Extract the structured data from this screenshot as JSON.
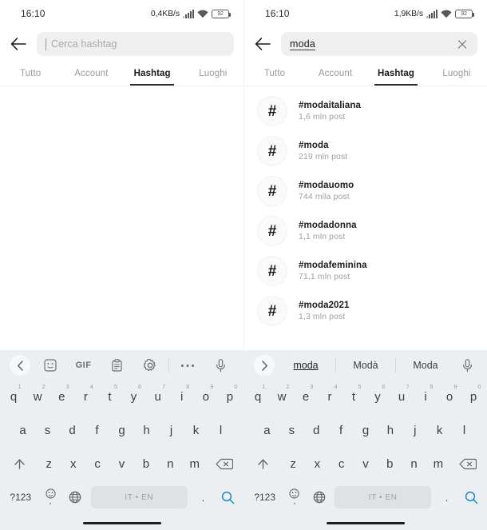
{
  "panels": [
    {
      "id": "left",
      "status": {
        "time": "16:10",
        "net_speed": "0,4KB/s",
        "battery": "92"
      },
      "search": {
        "placeholder": "Cerca hashtag",
        "value": "",
        "has_clear": false
      },
      "tabs": [
        {
          "label": "Tutto",
          "active": false
        },
        {
          "label": "Account",
          "active": false
        },
        {
          "label": "Hashtag",
          "active": true
        },
        {
          "label": "Luoghi",
          "active": false
        }
      ],
      "results": [],
      "keyboard": {
        "mode": "toolbar",
        "toolbar": [
          "chevron-left-icon",
          "sticker-icon",
          "GIF",
          "clipboard-icon",
          "gear-icon",
          "more-icon",
          "mic-icon"
        ],
        "gif_label": "GIF"
      }
    },
    {
      "id": "right",
      "status": {
        "time": "16:10",
        "net_speed": "1,9KB/s",
        "battery": "92"
      },
      "search": {
        "placeholder": "Cerca hashtag",
        "value": "moda",
        "has_clear": true
      },
      "tabs": [
        {
          "label": "Tutto",
          "active": false
        },
        {
          "label": "Account",
          "active": false
        },
        {
          "label": "Hashtag",
          "active": true
        },
        {
          "label": "Luoghi",
          "active": false
        }
      ],
      "results": [
        {
          "tag": "#modaitaliana",
          "posts": "1,6 mln post"
        },
        {
          "tag": "#moda",
          "posts": "219 mln post"
        },
        {
          "tag": "#modauomo",
          "posts": "744 mila post"
        },
        {
          "tag": "#modadonna",
          "posts": "1,1 mln post"
        },
        {
          "tag": "#modafeminina",
          "posts": "71,1 mln post"
        },
        {
          "tag": "#moda2021",
          "posts": "1,3 mln post"
        }
      ],
      "keyboard": {
        "mode": "suggestions",
        "suggestions": [
          "moda",
          "Modà",
          "Moda"
        ]
      }
    }
  ],
  "keyboard_layout": {
    "row1": [
      {
        "k": "q",
        "n": "1"
      },
      {
        "k": "w",
        "n": "2"
      },
      {
        "k": "e",
        "n": "3"
      },
      {
        "k": "r",
        "n": "4"
      },
      {
        "k": "t",
        "n": "5"
      },
      {
        "k": "y",
        "n": "6"
      },
      {
        "k": "u",
        "n": "7"
      },
      {
        "k": "i",
        "n": "8"
      },
      {
        "k": "o",
        "n": "9"
      },
      {
        "k": "p",
        "n": "0"
      }
    ],
    "row2": [
      "a",
      "s",
      "d",
      "f",
      "g",
      "h",
      "j",
      "k",
      "l"
    ],
    "row3": [
      "z",
      "x",
      "c",
      "v",
      "b",
      "n",
      "m"
    ],
    "shift": "shift-icon",
    "backspace": "backspace-icon",
    "symbols": "?123",
    "emoji": "emoji-icon",
    "comma": ",",
    "globe": "globe-icon",
    "space_label": "IT • EN",
    "period": ".",
    "search_key": "search-icon"
  },
  "colors": {
    "keyboard_bg": "#eceff1",
    "searchbox_bg": "#efefef",
    "accent_search_key": "#1e88c7",
    "tab_active": "#1a1a1a",
    "tab_inactive": "#9a9a9a"
  }
}
